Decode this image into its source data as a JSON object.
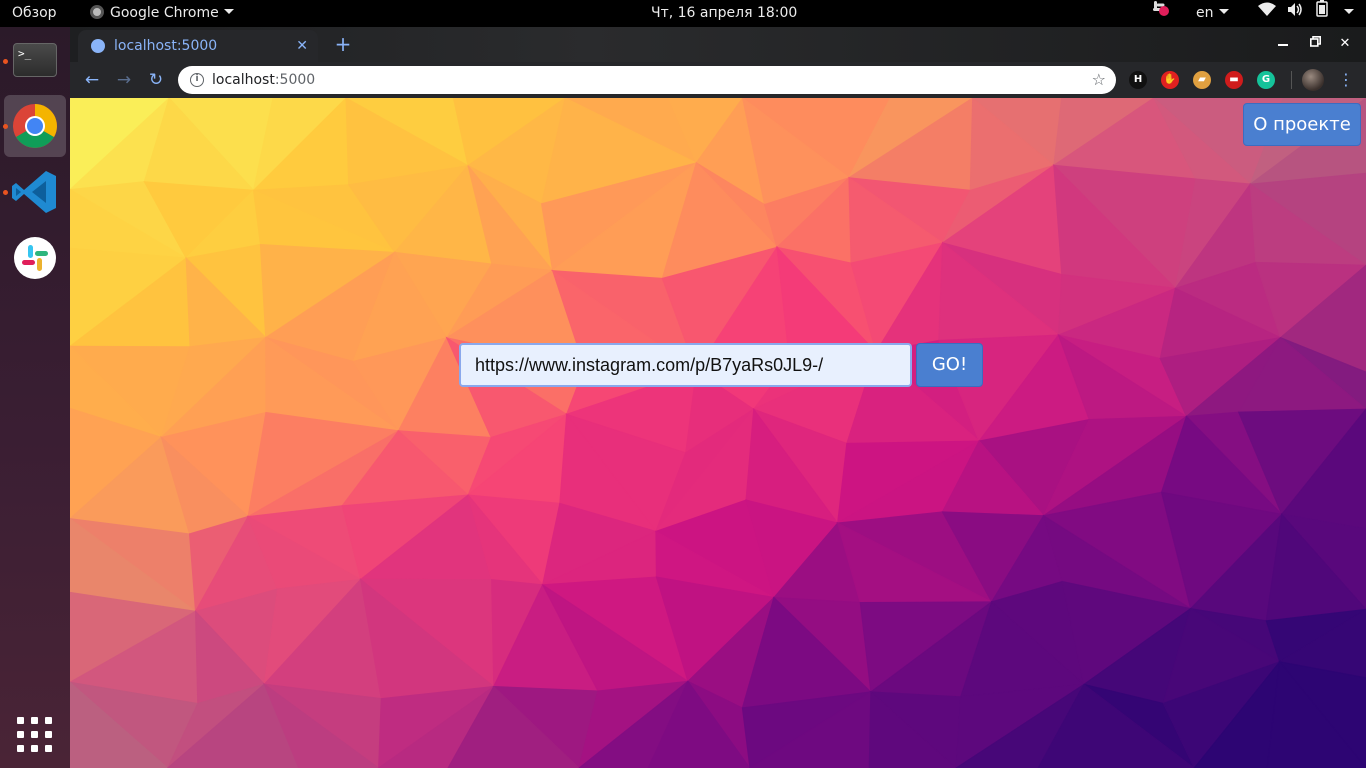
{
  "topbar": {
    "activities": "Обзор",
    "app_menu": "Google Chrome",
    "clock": "Чт, 16 апреля  18:00",
    "lang": "en"
  },
  "dock": {
    "items": [
      {
        "name": "terminal",
        "icon": "terminal-icon",
        "running": true
      },
      {
        "name": "chrome",
        "icon": "chrome-icon",
        "running": true,
        "active": true
      },
      {
        "name": "vscode",
        "icon": "vscode-icon",
        "running": true
      },
      {
        "name": "slack",
        "icon": "slack-icon",
        "running": false
      }
    ]
  },
  "browser": {
    "tab_title": "localhost:5000",
    "url_host": "localhost",
    "url_port": ":5000",
    "extensions": [
      {
        "icon": "h-extension-icon",
        "glyph": "H",
        "color": "#111111"
      },
      {
        "icon": "stop-extension-icon",
        "glyph": "✋",
        "color": "#e02020"
      },
      {
        "icon": "card-extension-icon",
        "glyph": "▰",
        "color": "#e0a040"
      },
      {
        "icon": "red-extension-icon",
        "glyph": "▬",
        "color": "#d01c1c"
      },
      {
        "icon": "grammarly-icon",
        "glyph": "G",
        "color": "#15c39a"
      }
    ]
  },
  "page": {
    "about_button": "О проекте",
    "url_input_value": "https://www.instagram.com/p/B7yaRs0JL9-/",
    "go_button": "GO!"
  },
  "colors": {
    "accent": "#4a7fd0",
    "topbar": "#000000",
    "chrome_frame": "#26272a",
    "link_blue": "#8ab4f8"
  }
}
